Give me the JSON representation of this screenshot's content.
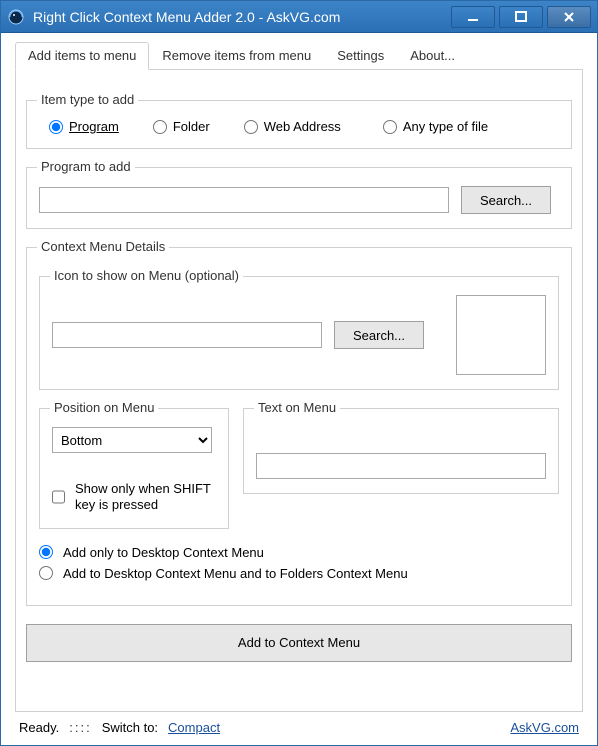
{
  "window": {
    "title": "Right Click Context Menu Adder 2.0  -  AskVG.com"
  },
  "tabs": [
    {
      "label": "Add items to menu",
      "active": true
    },
    {
      "label": "Remove items from menu"
    },
    {
      "label": "Settings"
    },
    {
      "label": "About..."
    }
  ],
  "groups": {
    "item_type": {
      "legend": "Item type to add",
      "options": {
        "program": "Program",
        "folder": "Folder",
        "web": "Web Address",
        "any": "Any type of file"
      },
      "selected": "program"
    },
    "program_to_add": {
      "legend": "Program to add",
      "value": "",
      "search_label": "Search..."
    },
    "context_details": {
      "legend": "Context Menu Details",
      "icon_group": {
        "legend": "Icon to show on Menu (optional)",
        "value": "",
        "search_label": "Search..."
      },
      "position_group": {
        "legend": "Position on Menu",
        "selected": "Bottom"
      },
      "text_group": {
        "legend": "Text on Menu",
        "value": ""
      },
      "shift_only": {
        "label": "Show only when SHIFT key is pressed",
        "checked": false
      },
      "scope": {
        "desktop_only": "Add only to Desktop Context Menu",
        "desktop_folders": "Add to Desktop Context Menu and to Folders Context Menu",
        "selected": "desktop_only"
      }
    }
  },
  "add_button": "Add to Context Menu",
  "status": {
    "ready": "Ready.",
    "switch_label": "Switch to:",
    "mode": "Compact",
    "site": "AskVG.com"
  }
}
